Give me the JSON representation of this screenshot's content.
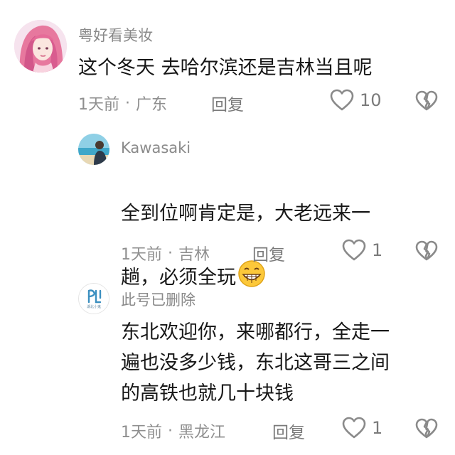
{
  "comments": [
    {
      "username": "粤好看美妆",
      "text": "这个冬天 去哈尔滨还是吉林当且呢",
      "time": "1天前",
      "location": "广东",
      "reply_label": "回复",
      "likes": "10",
      "avatar": "pink-hair-girl-avatar"
    },
    {
      "username": "Kawasaki",
      "text": "全到位啊肯定是，大老远来一\n趟，必须全玩",
      "emoji": "grinning-face-emoji",
      "time": "1天前",
      "location": "吉林",
      "reply_label": "回复",
      "likes": "1",
      "avatar": "beach-photo-avatar"
    },
    {
      "username": "此号已删除",
      "text": "东北欢迎你，来哪都行，全走一\n遍也没多少钱，东北这哥三之间\n的高铁也就几十块钱",
      "time": "1天前",
      "location": "黑龙江",
      "reply_label": "回复",
      "likes": "1",
      "avatar": "blue-logo-avatar",
      "avatar_label": "湖北小鬼"
    }
  ],
  "meta_separator": "·",
  "colors": {
    "text": "#161616",
    "muted": "#8f8f8f",
    "icon": "#8a8a8a"
  }
}
